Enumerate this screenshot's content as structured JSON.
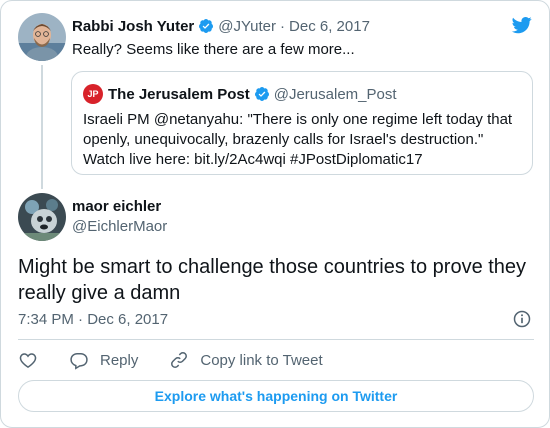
{
  "parent_tweet": {
    "author_name": "Rabbi Josh Yuter",
    "author_handle": "@JYuter",
    "separator": "·",
    "date": "Dec 6, 2017",
    "text": "Really? Seems like there are a few more...",
    "avatar_icon": "user-photo-icon"
  },
  "quoted_tweet": {
    "author_name": "The Jerusalem Post",
    "author_handle": "@Jerusalem_Post",
    "avatar_text": "JP",
    "text": "Israeli PM @netanyahu: \"There is only one regime left today that openly, unequivocally, brazenly calls for Israel's destruction.\" Watch live here: bit.ly/2Ac4wqi #JPostDiplomatic17"
  },
  "main_tweet": {
    "author_name": "maor eichler",
    "author_handle": "@EichlerMaor",
    "text": "Might be smart to challenge those countries to prove they really give a damn",
    "timestamp": "7:34 PM · Dec 6, 2017"
  },
  "actions": {
    "reply_label": "Reply",
    "copy_link_label": "Copy link to Tweet"
  },
  "explore_label": "Explore what's happening on Twitter",
  "colors": {
    "twitter_blue": "#1d9bf0",
    "verified_blue": "#1d9bf0",
    "text_primary": "#0f1419",
    "text_secondary": "#536471",
    "border": "#cfd9de",
    "jpost_red": "#d8222a"
  }
}
